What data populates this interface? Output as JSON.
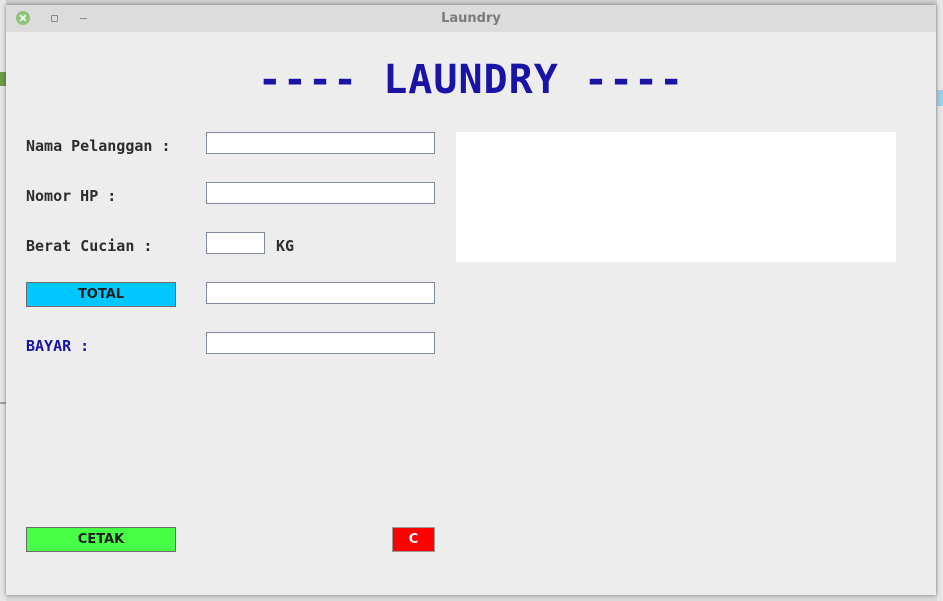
{
  "window": {
    "title": "Laundry"
  },
  "form": {
    "heading": "---- LAUNDRY ----",
    "labels": {
      "nama": "Nama Pelanggan :",
      "nomor": "Nomor HP :",
      "berat": "Berat Cucian :",
      "unit": "KG",
      "bayar": "BAYAR :"
    },
    "buttons": {
      "total": "TOTAL",
      "cetak": "CETAK",
      "clear": "C"
    },
    "fields": {
      "nama": "",
      "nomor": "",
      "berat": "",
      "total": "",
      "bayar": ""
    },
    "output_text": ""
  },
  "colors": {
    "heading": "#1a14a6",
    "total_button": "#00c8ff",
    "cetak_button": "#46ff46",
    "clear_button": "#ff0000"
  }
}
